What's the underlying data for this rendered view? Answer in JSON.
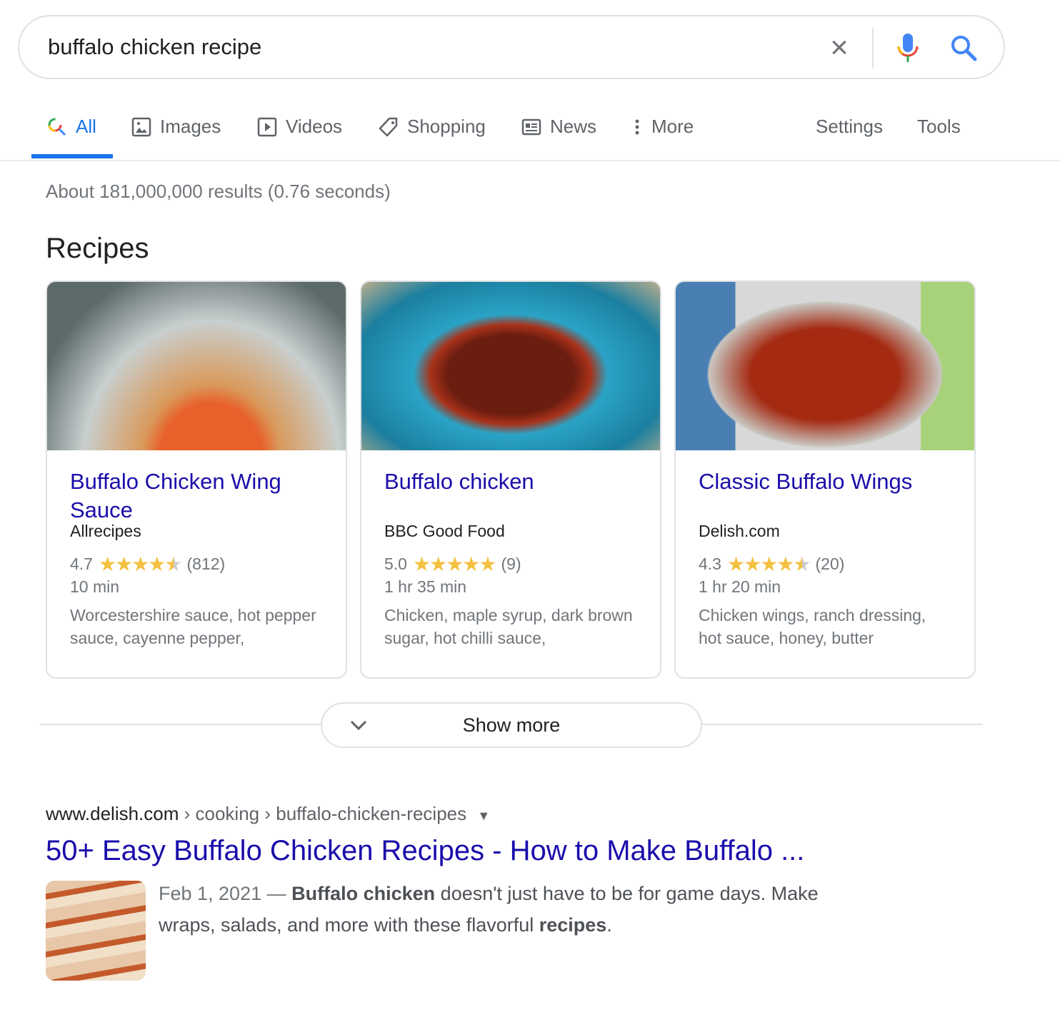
{
  "search": {
    "query": "buffalo chicken recipe"
  },
  "tabs": [
    {
      "label": "All",
      "icon": "search-icon",
      "active": true
    },
    {
      "label": "Images",
      "icon": "image-icon"
    },
    {
      "label": "Videos",
      "icon": "play-icon"
    },
    {
      "label": "Shopping",
      "icon": "tag-icon"
    },
    {
      "label": "News",
      "icon": "news-icon"
    },
    {
      "label": "More",
      "icon": "more-vert-icon"
    }
  ],
  "tools": {
    "settings": "Settings",
    "tools": "Tools"
  },
  "stats": "About 181,000,000 results (0.76 seconds)",
  "recipes": {
    "title": "Recipes",
    "cards": [
      {
        "title": "Buffalo Chicken Wing Sauce",
        "source": "Allrecipes",
        "rating": "4.7",
        "rating_value": 4.7,
        "stars": "★★★★½",
        "count": "(812)",
        "time": "10 min",
        "ingredients": "Worcestershire sauce, hot pepper sauce, cayenne pepper,"
      },
      {
        "title": "Buffalo chicken",
        "source": "BBC Good Food",
        "rating": "5.0",
        "rating_value": 5.0,
        "stars": "★★★★★",
        "count": "(9)",
        "time": "1 hr 35 min",
        "ingredients": "Chicken, maple syrup, dark brown sugar, hot chilli sauce,"
      },
      {
        "title": "Classic Buffalo Wings",
        "source": "Delish.com",
        "rating": "4.3",
        "rating_value": 4.3,
        "stars": "★★★★½",
        "count": "(20)",
        "time": "1 hr 20 min",
        "ingredients": "Chicken wings, ranch dressing, hot sauce, honey, butter"
      }
    ],
    "show_more": "Show more"
  },
  "result": {
    "domain": "www.delish.com",
    "path": " › cooking › buffalo-chicken-recipes",
    "title": "50+ Easy Buffalo Chicken Recipes - How to Make Buffalo ...",
    "date": "Feb 1, 2021 — ",
    "snippet_b1": "Buffalo chicken",
    "snippet_t1": " doesn't just have to be for game days. Make wraps, salads, and more with these flavorful ",
    "snippet_b2": "recipes",
    "snippet_t2": "."
  },
  "colors": {
    "link": "#1a0dab",
    "accent": "#1a73e8",
    "star": "#f4c040"
  }
}
